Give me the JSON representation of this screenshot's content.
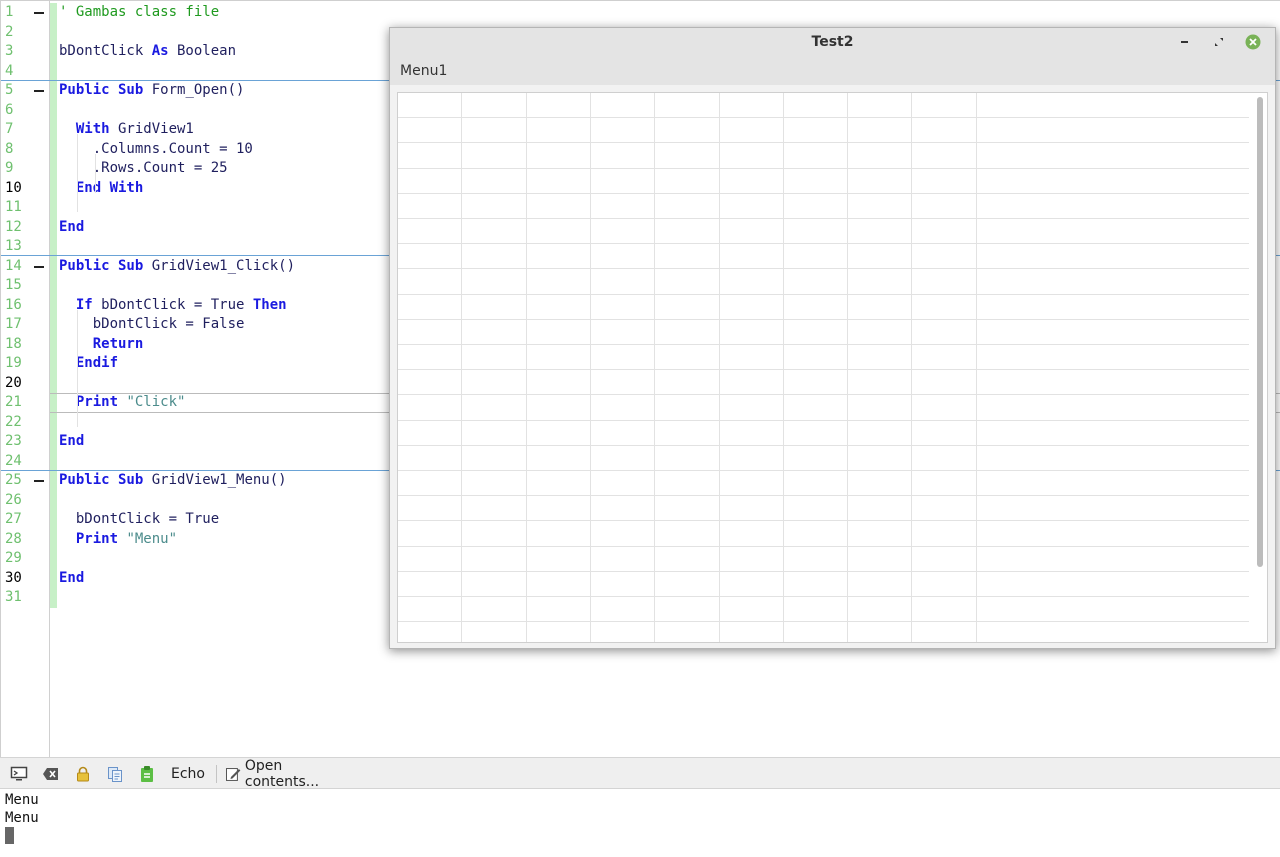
{
  "editor": {
    "lines": [
      {
        "n": "1",
        "fold": true,
        "parts": [
          {
            "t": "' Gambas class file",
            "c": "cm"
          }
        ]
      },
      {
        "n": "2",
        "parts": []
      },
      {
        "n": "3",
        "parts": [
          {
            "t": "bDontClick "
          },
          {
            "t": "As",
            "c": "kw"
          },
          {
            "t": " Boolean"
          }
        ]
      },
      {
        "n": "4",
        "parts": []
      },
      {
        "n": "5",
        "fold": true,
        "parts": [
          {
            "t": "Public Sub",
            "c": "kw"
          },
          {
            "t": " Form_Open()"
          }
        ]
      },
      {
        "n": "6",
        "parts": []
      },
      {
        "n": "7",
        "parts": [
          {
            "t": "  "
          },
          {
            "t": "With",
            "c": "kw"
          },
          {
            "t": " GridView1"
          }
        ]
      },
      {
        "n": "8",
        "parts": [
          {
            "t": "    .Columns.Count = 10"
          }
        ]
      },
      {
        "n": "9",
        "parts": [
          {
            "t": "    .Rows.Count = 25"
          }
        ]
      },
      {
        "n": "10",
        "cur": true,
        "parts": [
          {
            "t": "  "
          },
          {
            "t": "End With",
            "c": "kw"
          }
        ]
      },
      {
        "n": "11",
        "parts": []
      },
      {
        "n": "12",
        "parts": [
          {
            "t": "End",
            "c": "kw"
          }
        ]
      },
      {
        "n": "13",
        "parts": []
      },
      {
        "n": "14",
        "fold": true,
        "parts": [
          {
            "t": "Public Sub",
            "c": "kw"
          },
          {
            "t": " GridView1_Click()"
          }
        ]
      },
      {
        "n": "15",
        "parts": []
      },
      {
        "n": "16",
        "parts": [
          {
            "t": "  "
          },
          {
            "t": "If",
            "c": "kw"
          },
          {
            "t": " bDontClick = True "
          },
          {
            "t": "Then",
            "c": "kw"
          }
        ]
      },
      {
        "n": "17",
        "parts": [
          {
            "t": "    bDontClick = False"
          }
        ]
      },
      {
        "n": "18",
        "parts": [
          {
            "t": "    "
          },
          {
            "t": "Return",
            "c": "kw"
          }
        ]
      },
      {
        "n": "19",
        "parts": [
          {
            "t": "  "
          },
          {
            "t": "Endif",
            "c": "kw"
          }
        ]
      },
      {
        "n": "20",
        "cur": true,
        "parts": []
      },
      {
        "n": "21",
        "parts": [
          {
            "t": "  "
          },
          {
            "t": "Print",
            "c": "kw"
          },
          {
            "t": " "
          },
          {
            "t": "\"Click\"",
            "c": "st"
          }
        ]
      },
      {
        "n": "22",
        "parts": []
      },
      {
        "n": "23",
        "parts": [
          {
            "t": "End",
            "c": "kw"
          }
        ]
      },
      {
        "n": "24",
        "parts": []
      },
      {
        "n": "25",
        "fold": true,
        "parts": [
          {
            "t": "Public Sub",
            "c": "kw"
          },
          {
            "t": " GridView1_Menu()"
          }
        ]
      },
      {
        "n": "26",
        "parts": []
      },
      {
        "n": "27",
        "parts": [
          {
            "t": "  bDontClick = True"
          }
        ]
      },
      {
        "n": "28",
        "parts": [
          {
            "t": "  "
          },
          {
            "t": "Print",
            "c": "kw"
          },
          {
            "t": " "
          },
          {
            "t": "\"Menu\"",
            "c": "st"
          }
        ]
      },
      {
        "n": "29",
        "parts": []
      },
      {
        "n": "30",
        "cur": true,
        "parts": [
          {
            "t": "End",
            "c": "kw"
          }
        ]
      },
      {
        "n": "31",
        "parts": []
      }
    ]
  },
  "console": {
    "echo_label": "Echo",
    "open_contents_label": "Open contents...",
    "output_lines": [
      "Menu",
      "Menu"
    ]
  },
  "window": {
    "title": "Test2",
    "menu_label": "Menu1"
  }
}
